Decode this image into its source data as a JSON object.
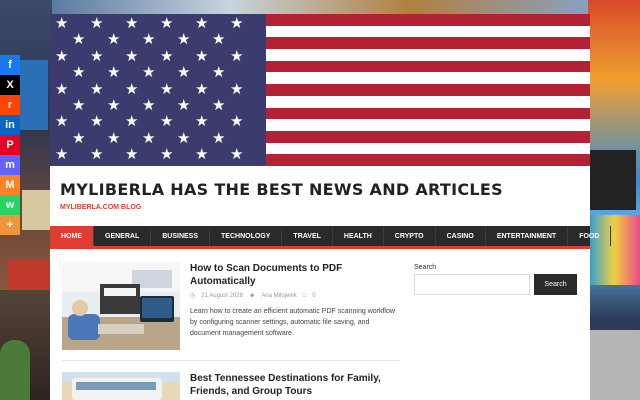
{
  "share_bar": [
    {
      "icon": "facebook-icon",
      "glyph": "f",
      "color": "#1877f2"
    },
    {
      "icon": "x-twitter-icon",
      "glyph": "X",
      "color": "#000000"
    },
    {
      "icon": "reddit-icon",
      "glyph": "r",
      "color": "#ff4500"
    },
    {
      "icon": "linkedin-icon",
      "glyph": "in",
      "color": "#0a66c2"
    },
    {
      "icon": "pinterest-icon",
      "glyph": "P",
      "color": "#e60023"
    },
    {
      "icon": "mastodon-icon",
      "glyph": "m",
      "color": "#6364ff"
    },
    {
      "icon": "mix-icon",
      "glyph": "M",
      "color": "#ff8226"
    },
    {
      "icon": "whatsapp-icon",
      "glyph": "w",
      "color": "#25d366"
    },
    {
      "icon": "more-share-icon",
      "glyph": "+",
      "color": "#f0963a"
    }
  ],
  "header": {
    "site_title": "MYLIBERLA HAS THE BEST NEWS AND ARTICLES",
    "tagline": "MYLIBERLA.COM BLOG"
  },
  "nav": {
    "items": [
      "HOME",
      "GENERAL",
      "BUSINESS",
      "TECHNOLOGY",
      "TRAVEL",
      "HEALTH",
      "CRYPTO",
      "CASINO",
      "ENTERTAINMENT",
      "FOOD"
    ],
    "active_index": 0
  },
  "articles": [
    {
      "title": "How to Scan Documents to PDF Automatically",
      "date": "21 August 2026",
      "author": "Ana Milojevik",
      "comments": "0",
      "excerpt": "Learn how to create an efficient automatic PDF scanning workflow by configuring scanner settings, automatic file saving, and document management software."
    },
    {
      "title": "Best Tennessee Destinations for Family, Friends, and Group Tours"
    }
  ],
  "sidebar": {
    "search_label": "Search",
    "search_placeholder": "",
    "search_button": "Search"
  },
  "colors": {
    "accent": "#e03c31",
    "nav_bg": "#2a2a2a",
    "flag_red": "#b22234",
    "flag_blue": "#3c3b6e"
  }
}
